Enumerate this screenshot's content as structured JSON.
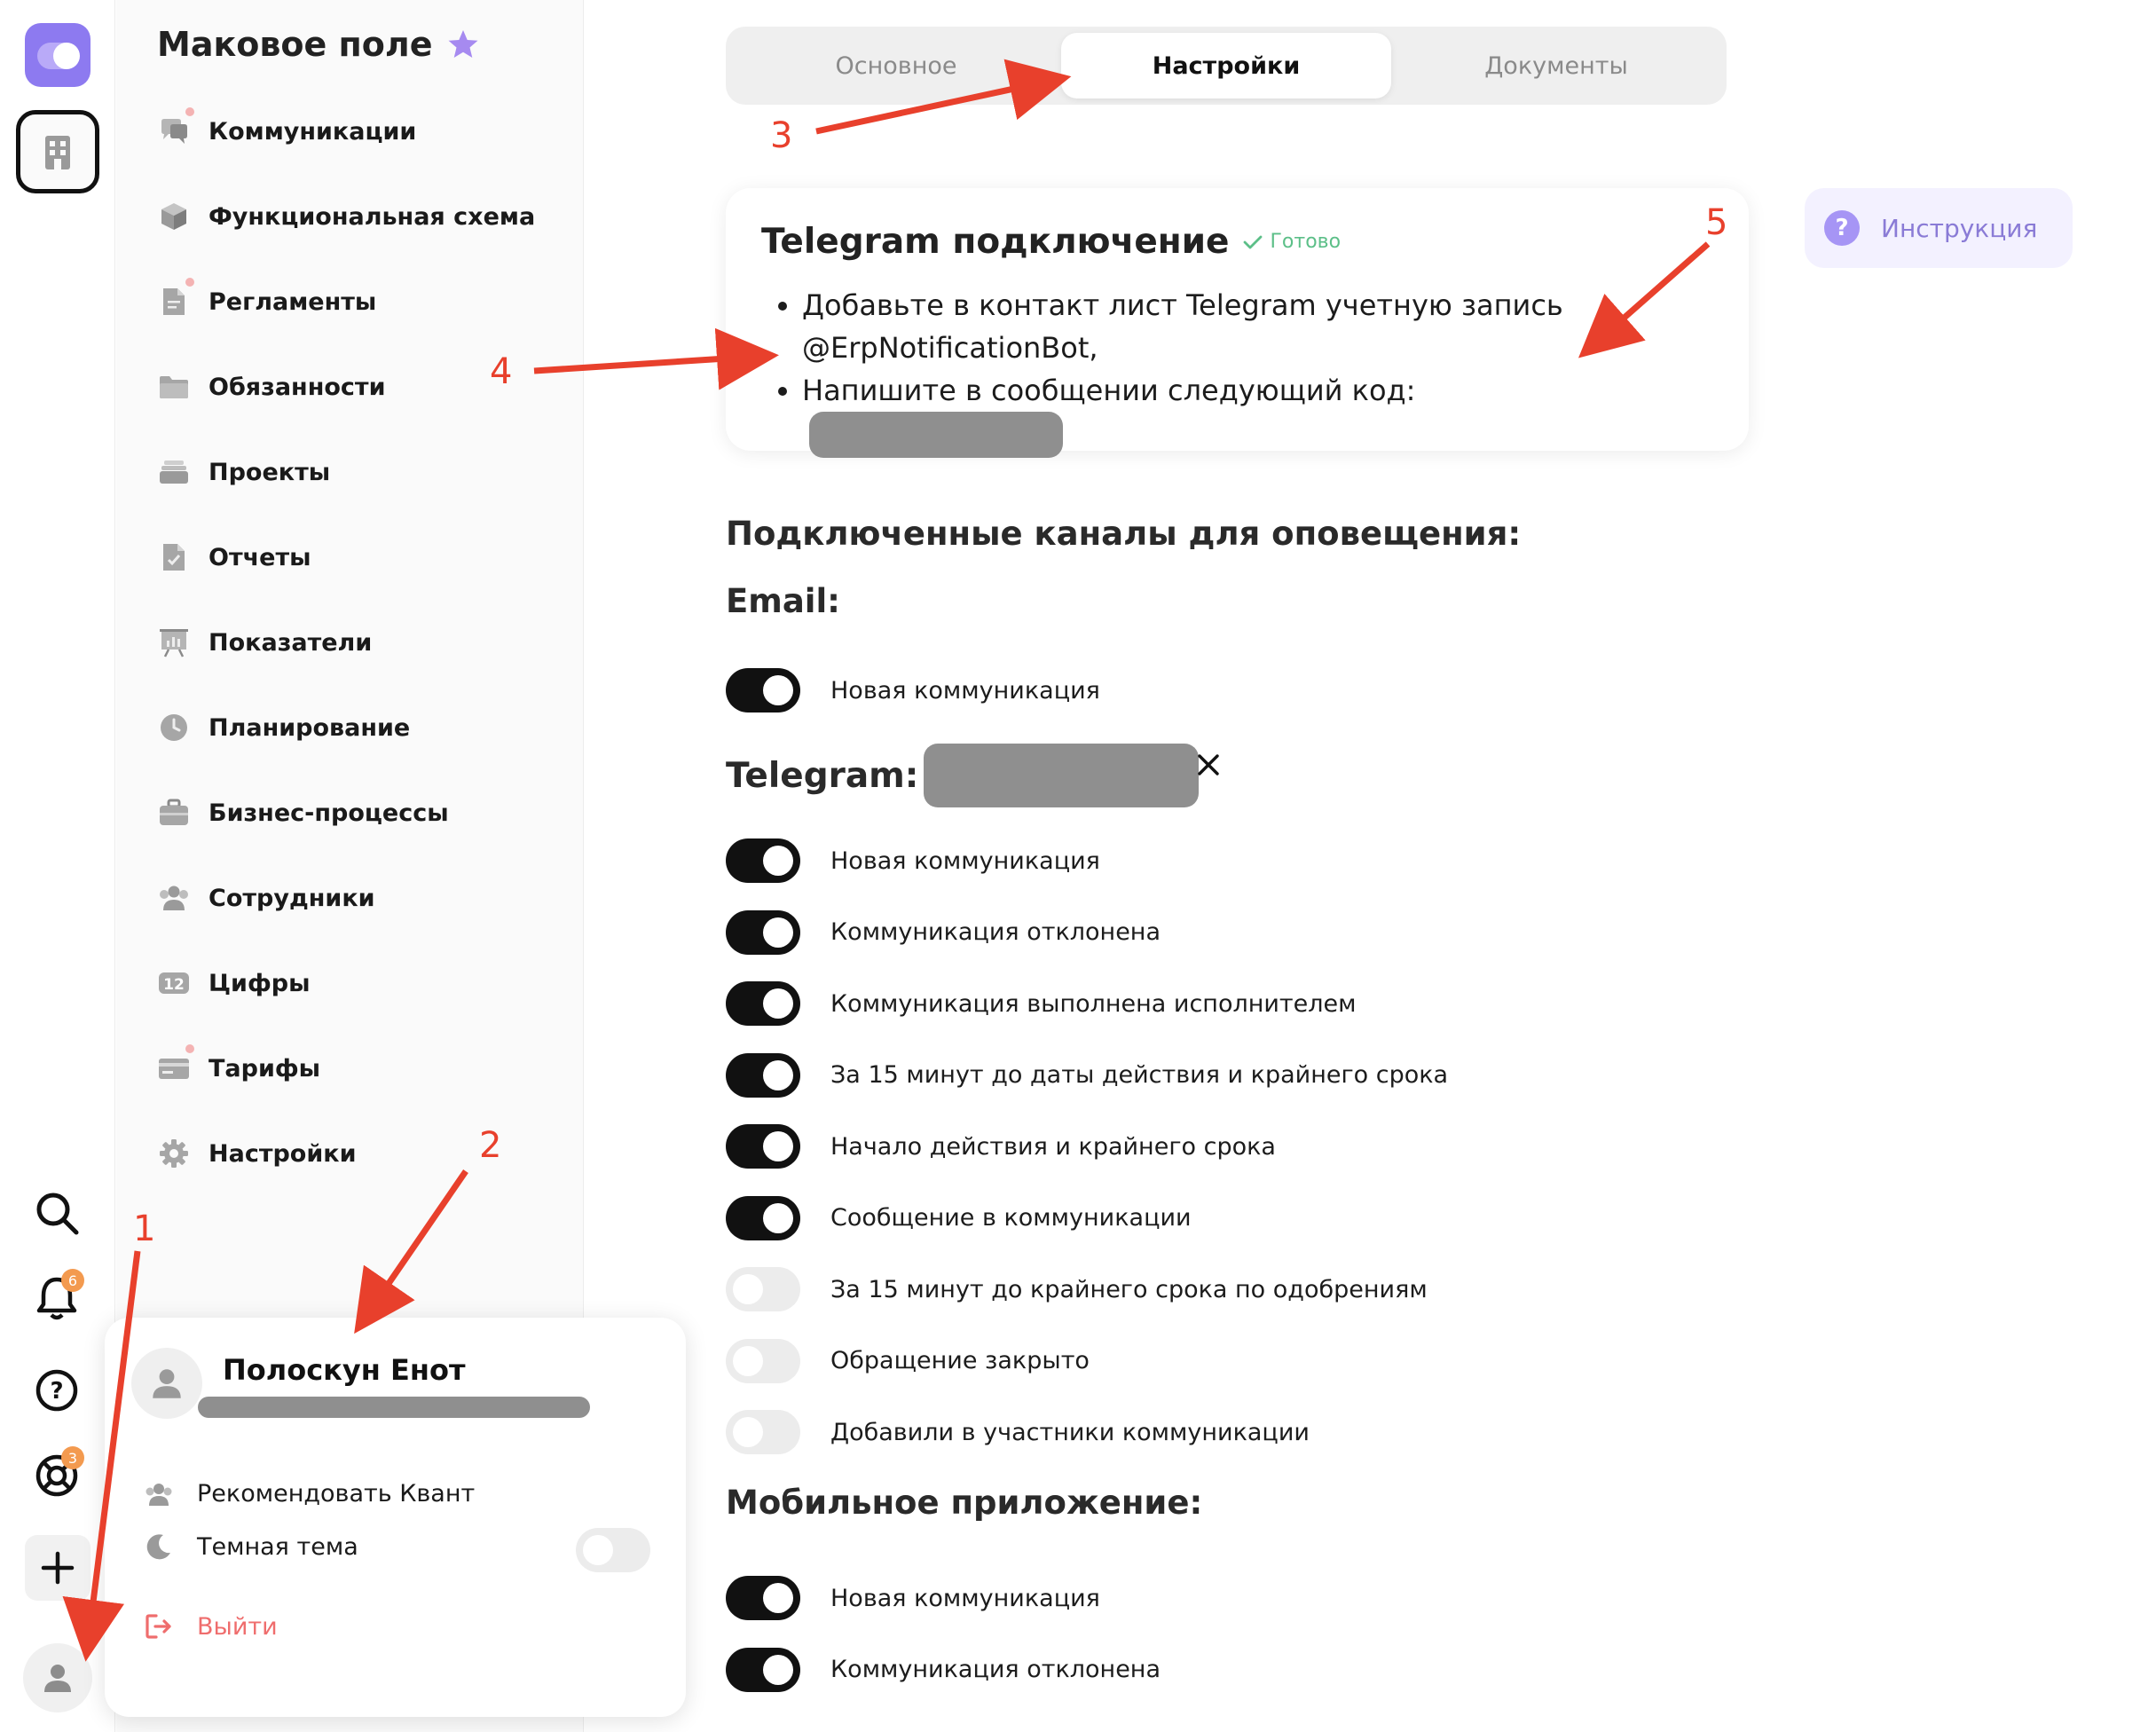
{
  "rail": {
    "notifications_badge": "6",
    "support_badge": "3"
  },
  "sidebar": {
    "company_name": "Маковое поле",
    "items": [
      {
        "label": "Коммуникации",
        "icon": "chat-icon"
      },
      {
        "label": "Функциональная схема",
        "icon": "cube-icon"
      },
      {
        "label": "Регламенты",
        "icon": "document-icon"
      },
      {
        "label": "Обязанности",
        "icon": "folder-icon"
      },
      {
        "label": "Проекты",
        "icon": "stack-icon"
      },
      {
        "label": "Отчеты",
        "icon": "report-icon"
      },
      {
        "label": "Показатели",
        "icon": "presentation-icon"
      },
      {
        "label": "Планирование",
        "icon": "clock-icon"
      },
      {
        "label": "Бизнес-процессы",
        "icon": "briefcase-icon"
      },
      {
        "label": "Сотрудники",
        "icon": "people-icon"
      },
      {
        "label": "Цифры",
        "icon": "numbers-icon",
        "icon_text": "12"
      },
      {
        "label": "Тарифы",
        "icon": "card-icon"
      },
      {
        "label": "Настройки",
        "icon": "gear-icon"
      }
    ]
  },
  "popup": {
    "user_name": "Полоскун Енот",
    "recommend_label": "Рекомендовать Квант",
    "dark_theme_label": "Темная тема",
    "dark_theme_on": false,
    "logout_label": "Выйти"
  },
  "tabs": [
    {
      "label": "Основное",
      "active": false
    },
    {
      "label": "Настройки",
      "active": true
    },
    {
      "label": "Документы",
      "active": false
    }
  ],
  "telegram_card": {
    "title": "Telegram подключение",
    "status": "Готово",
    "line1": "Добавьте в контакт лист Telegram учетную запись @ErpNotificationBot,",
    "line2": "Напишите в сообщении следующий код:"
  },
  "help_button": {
    "label": "Инструкция",
    "icon_text": "?"
  },
  "channels": {
    "title": "Подключенные каналы для оповещения:",
    "email_title": "Email:",
    "email_items": [
      {
        "label": "Новая коммуникация",
        "on": true
      }
    ],
    "telegram_title": "Telegram:",
    "telegram_items": [
      {
        "label": "Новая коммуникация",
        "on": true
      },
      {
        "label": "Коммуникация отклонена",
        "on": true
      },
      {
        "label": "Коммуникация выполнена исполнителем",
        "on": true
      },
      {
        "label": "За 15 минут до даты действия и крайнего срока",
        "on": true
      },
      {
        "label": "Начало действия и крайнего срока",
        "on": true
      },
      {
        "label": "Сообщение в коммуникации",
        "on": true
      },
      {
        "label": "За 15 минут до крайнего срока по одобрениям",
        "on": false
      },
      {
        "label": "Обращение закрыто",
        "on": false
      },
      {
        "label": "Добавили в участники коммуникации",
        "on": false
      }
    ],
    "mobile_title": "Мобильное приложение:",
    "mobile_items": [
      {
        "label": "Новая коммуникация",
        "on": true
      },
      {
        "label": "Коммуникация отклонена",
        "on": true
      }
    ]
  },
  "annotations": [
    "1",
    "2",
    "3",
    "4",
    "5"
  ],
  "colors": {
    "accent": "#8d7af0",
    "annotation": "#e8402c",
    "ready": "#5cbf88",
    "logout": "#ef6d6d"
  }
}
